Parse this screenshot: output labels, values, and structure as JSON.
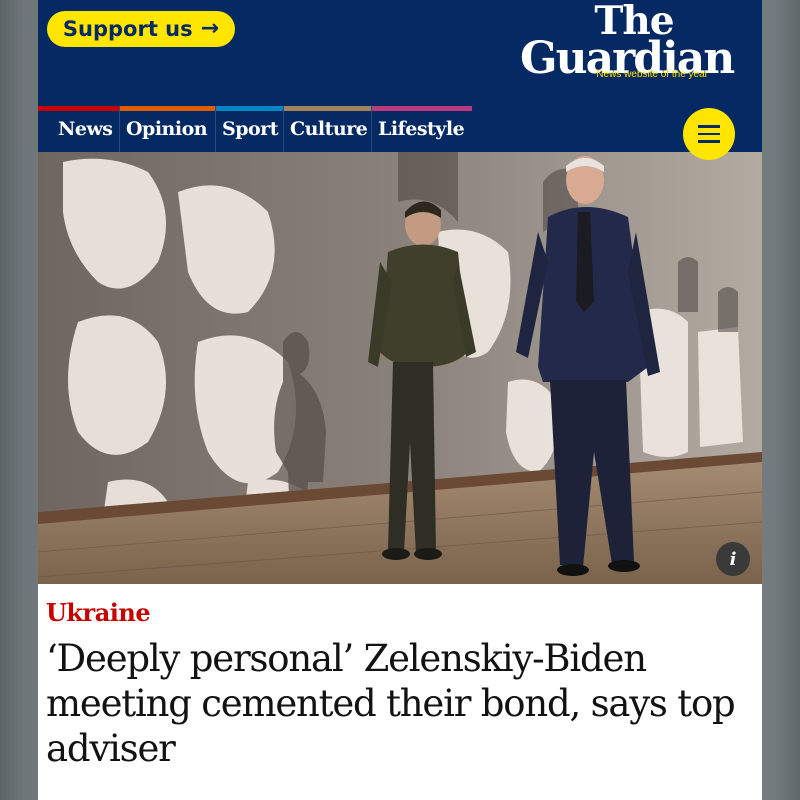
{
  "header": {
    "support_label": "Support us",
    "support_arrow": "→",
    "logo_line1": "The",
    "logo_line2": "Guardian",
    "tagline": "News website of the year"
  },
  "nav": {
    "items": [
      {
        "label": "News",
        "color": "#c70000"
      },
      {
        "label": "Opinion",
        "color": "#e05e00"
      },
      {
        "label": "Sport",
        "color": "#0084c6"
      },
      {
        "label": "Culture",
        "color": "#a1845c"
      },
      {
        "label": "Lifestyle",
        "color": "#bb3b80"
      }
    ],
    "menu_icon": "hamburger-menu-icon"
  },
  "hero": {
    "info_label": "i",
    "info_icon": "info-icon"
  },
  "article": {
    "kicker": "Ukraine",
    "headline": "‘Deeply personal’ Zelenskiy-Biden meeting cemented their bond, says top adviser"
  },
  "colors": {
    "brand_blue": "#052962",
    "support_yellow": "#ffe500",
    "kicker_red": "#c70000"
  }
}
